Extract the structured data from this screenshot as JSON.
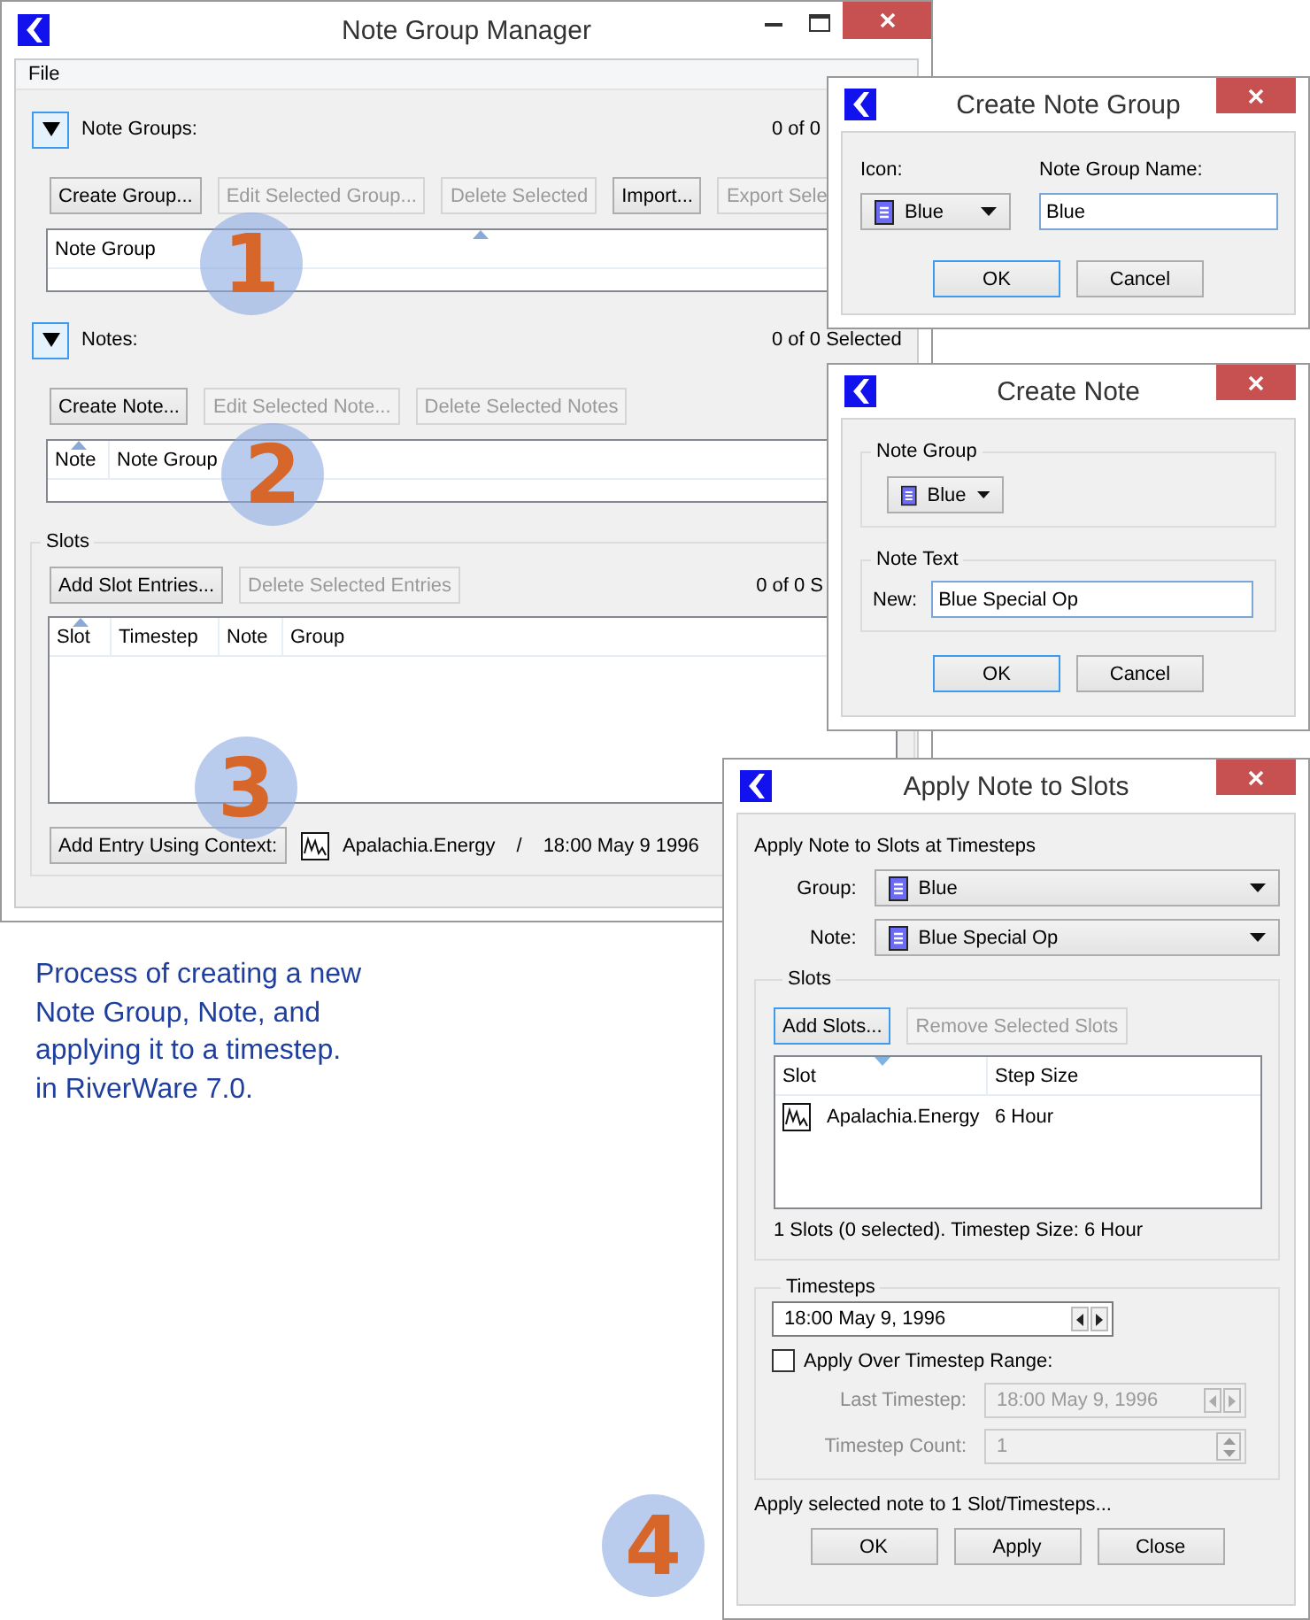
{
  "main_window": {
    "title": "Note Group Manager",
    "menu": [
      {
        "label": "File"
      }
    ],
    "sections": [
      {
        "expanded": true,
        "label": "Note Groups:",
        "count": "0 of 0",
        "buttons": [
          {
            "label": "Create Group...",
            "disabled": false
          },
          {
            "label": "Edit Selected Group...",
            "disabled": true
          },
          {
            "label": "Delete Selected",
            "disabled": true
          },
          {
            "label": "Import...",
            "disabled": false
          },
          {
            "label": "Export Sele",
            "disabled": true
          }
        ],
        "columns": [
          {
            "label": "Note Group",
            "sorted": true
          }
        ]
      },
      {
        "expanded": true,
        "label": "Notes:",
        "count": "0 of 0 Selected",
        "buttons": [
          {
            "label": "Create Note...",
            "disabled": false
          },
          {
            "label": "Edit Selected Note...",
            "disabled": true
          },
          {
            "label": "Delete Selected Notes",
            "disabled": true
          }
        ],
        "columns": [
          {
            "label": "Note",
            "sorted": true
          },
          {
            "label": "Note Group",
            "sorted": false
          }
        ]
      }
    ],
    "slots": {
      "label": "Slots",
      "buttons": [
        {
          "label": "Add Slot Entries...",
          "disabled": false
        },
        {
          "label": "Delete Selected Entries",
          "disabled": true
        }
      ],
      "count": "0 of 0 S",
      "columns": [
        {
          "label": "Slot",
          "sorted": true
        },
        {
          "label": "Timestep",
          "sorted": false
        },
        {
          "label": "Note",
          "sorted": false
        },
        {
          "label": "Group",
          "sorted": false
        }
      ],
      "context_button": "Add Entry Using Context:",
      "context_slot": "Apalachia.Energy",
      "context_separator": "/",
      "context_time": "18:00 May 9 1996"
    }
  },
  "caption": "Process of creating a new\nNote Group, Note, and\napplying it to a timestep.\nin RiverWare 7.0.",
  "create_group_dialog": {
    "title": "Create Note Group",
    "icon_label": "Icon:",
    "icon_value": "Blue",
    "name_label": "Note Group Name:",
    "name_value": "Blue",
    "buttons": [
      {
        "label": "OK",
        "focused": true
      },
      {
        "label": "Cancel",
        "focused": false
      }
    ]
  },
  "create_note_dialog": {
    "title": "Create Note",
    "group_box": "Note Group",
    "group_value": "Blue",
    "text_box": "Note Text",
    "text_label": "New:",
    "text_value": "Blue Special Op",
    "buttons": [
      {
        "label": "OK",
        "focused": true
      },
      {
        "label": "Cancel",
        "focused": false
      }
    ]
  },
  "apply_dialog": {
    "title": "Apply Note to Slots",
    "heading": "Apply Note to Slots at Timesteps",
    "group": {
      "label": "Group:",
      "value": "Blue"
    },
    "note": {
      "label": "Note:",
      "value": "Blue Special Op"
    },
    "slots": {
      "label": "Slots",
      "buttons": [
        {
          "label": "Add Slots...",
          "disabled": false,
          "focused": true
        },
        {
          "label": "Remove Selected Slots",
          "disabled": true,
          "focused": false
        }
      ],
      "columns": [
        {
          "label": "Slot",
          "sorted": true
        },
        {
          "label": "Step Size",
          "sorted": false
        }
      ],
      "rows": [
        {
          "slot": "Apalachia.Energy",
          "step_size": "6 Hour"
        }
      ],
      "summary": "1 Slots (0 selected). Timestep Size: 6 Hour"
    },
    "timesteps": {
      "label": "Timesteps",
      "start": "18:00 May 9, 1996",
      "range": {
        "label": "Apply Over Timestep Range:",
        "checked": false
      },
      "last": {
        "label": "Last Timestep:",
        "value": "18:00 May 9, 1996",
        "disabled": true
      },
      "count": {
        "label": "Timestep Count:",
        "value": "1",
        "disabled": true
      }
    },
    "message": "Apply selected note to 1 Slot/Timesteps...",
    "buttons": [
      {
        "label": "OK"
      },
      {
        "label": "Apply"
      },
      {
        "label": "Close"
      }
    ]
  },
  "step_markers": [
    "1",
    "2",
    "3",
    "4"
  ]
}
